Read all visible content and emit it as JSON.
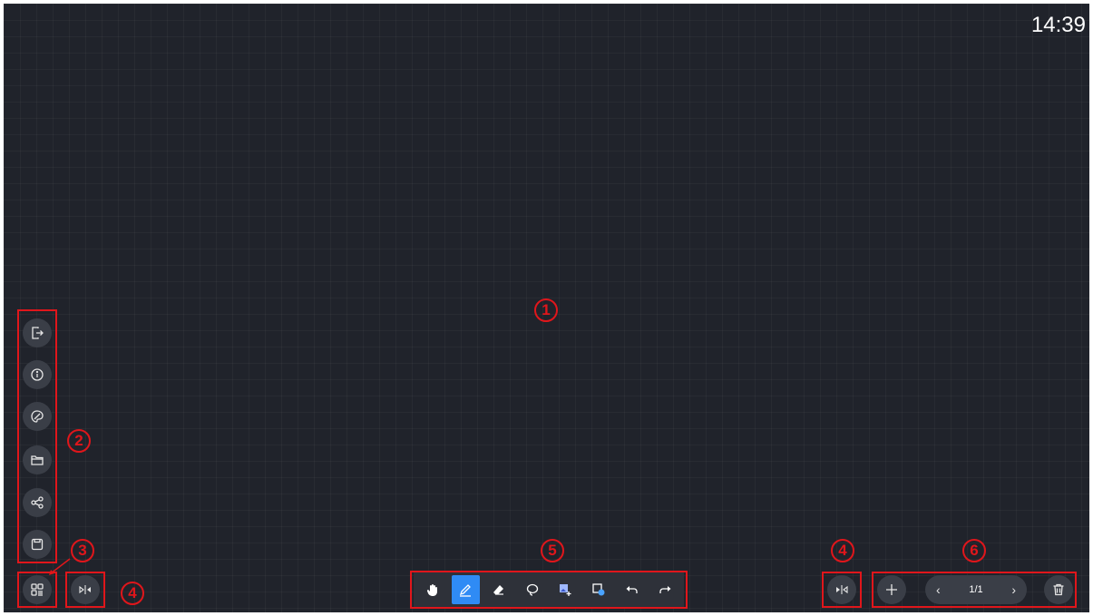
{
  "clock": {
    "time": "14:39"
  },
  "annotations": {
    "canvas": "1",
    "left_menu": "2",
    "apps": "3",
    "toggle_left": "4",
    "toolbar": "5",
    "toggle_right": "4",
    "page_controls": "6"
  },
  "left_menu": {
    "items": [
      {
        "icon": "exit-icon"
      },
      {
        "icon": "info-icon"
      },
      {
        "icon": "theme-icon"
      },
      {
        "icon": "folder-icon"
      },
      {
        "icon": "share-icon"
      },
      {
        "icon": "save-icon"
      }
    ]
  },
  "toolbar": {
    "tools": [
      {
        "icon": "hand-icon",
        "active": false
      },
      {
        "icon": "pen-icon",
        "active": true
      },
      {
        "icon": "eraser-icon",
        "active": false
      },
      {
        "icon": "lasso-icon",
        "active": false
      },
      {
        "icon": "insert-image-icon",
        "active": false
      },
      {
        "icon": "shape-icon",
        "active": false
      },
      {
        "icon": "undo-icon",
        "active": false
      },
      {
        "icon": "redo-icon",
        "active": false
      }
    ]
  },
  "page_controls": {
    "page_indicator": "1/1",
    "prev": "‹",
    "next": "›"
  },
  "colors": {
    "canvas_bg": "#20232b",
    "accent": "#2f8bf5",
    "annotation_red": "#e0161b"
  }
}
